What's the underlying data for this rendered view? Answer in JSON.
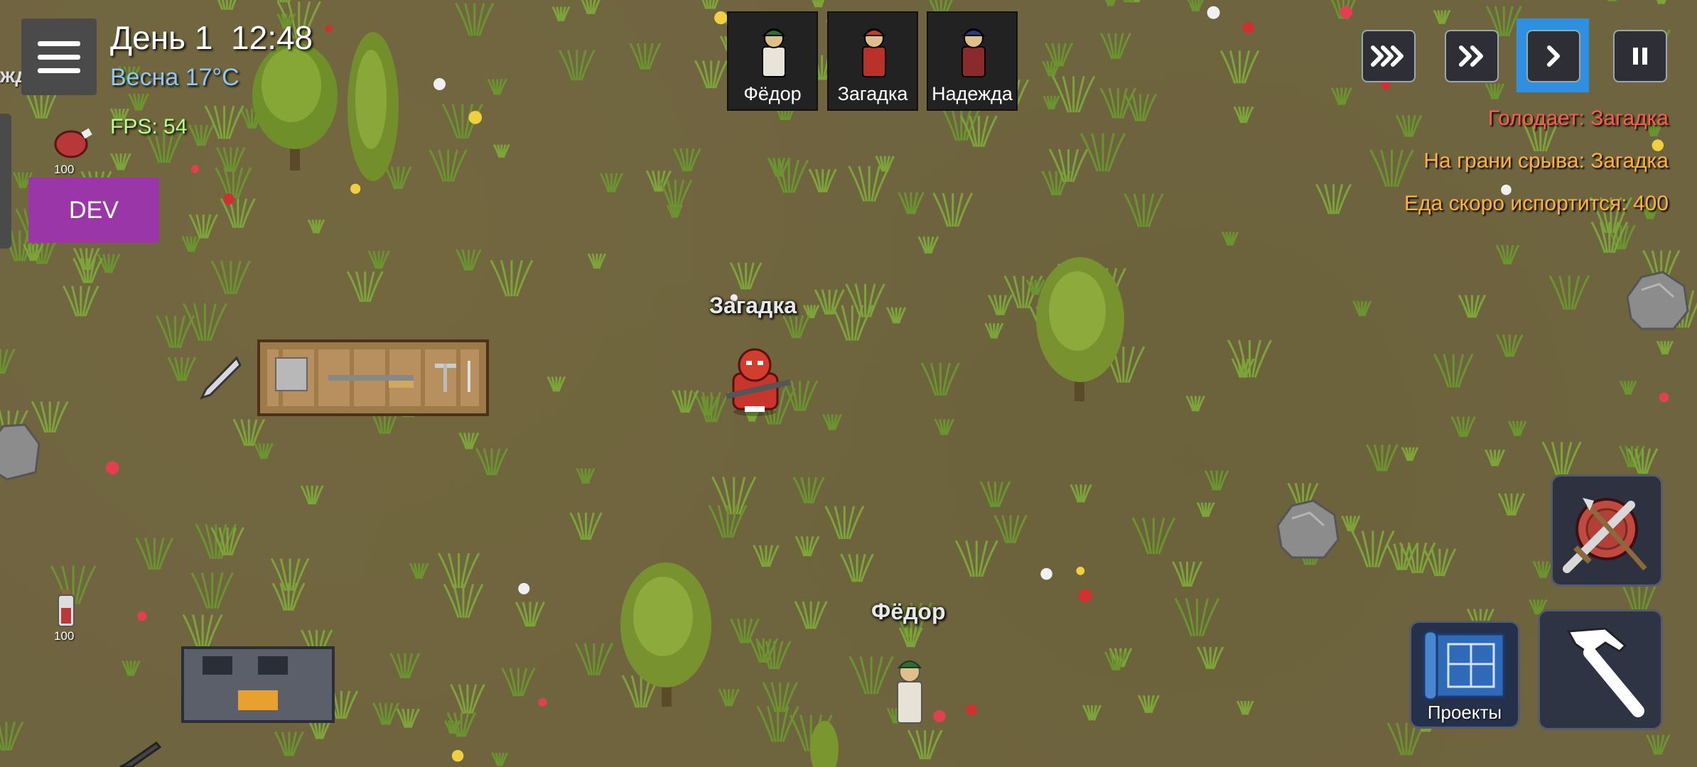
{
  "hud": {
    "day": "День 1",
    "time": "12:48",
    "season": "Весна 17°C",
    "fps": "FPS: 54",
    "dev_label": "DEV",
    "edge_name_fragment": "жда"
  },
  "colonists": [
    {
      "name": "Фёдор",
      "hat_color": "#2f6b34",
      "body_color": "#e8e4da"
    },
    {
      "name": "Загадка",
      "hat_color": "#c83a2a",
      "body_color": "#b8322a"
    },
    {
      "name": "Надежда",
      "hat_color": "#2a3c7a",
      "body_color": "#8a2a2a"
    }
  ],
  "speed_controls": [
    {
      "name": "speed-3x-button",
      "icon": "triple-chevron-icon",
      "active": false
    },
    {
      "name": "speed-2x-button",
      "icon": "double-chevron-icon",
      "active": false
    },
    {
      "name": "speed-1x-button",
      "icon": "chevron-right-icon",
      "active": true
    },
    {
      "name": "pause-button",
      "icon": "pause-icon",
      "active": false
    }
  ],
  "alerts": [
    {
      "text": "Голодает: Загадка",
      "color": "#ff5a4a"
    },
    {
      "text": "На грани срыва: Загадка",
      "color": "#ffb040"
    },
    {
      "text": "Еда скоро испортится: 400",
      "color": "#ffb040"
    }
  ],
  "world_labels": {
    "zagadka": "Загадка",
    "fedor": "Фёдор"
  },
  "items": {
    "meat_count": "100",
    "potion_count": "100"
  },
  "actions": {
    "projects_label": "Проекты",
    "combat_icon": "sword-shield-icon",
    "build_icon": "hammer-icon"
  },
  "colors": {
    "ground": "#6f6440",
    "accent_active": "#2f8fe0",
    "dev_button": "#9b36a8"
  }
}
